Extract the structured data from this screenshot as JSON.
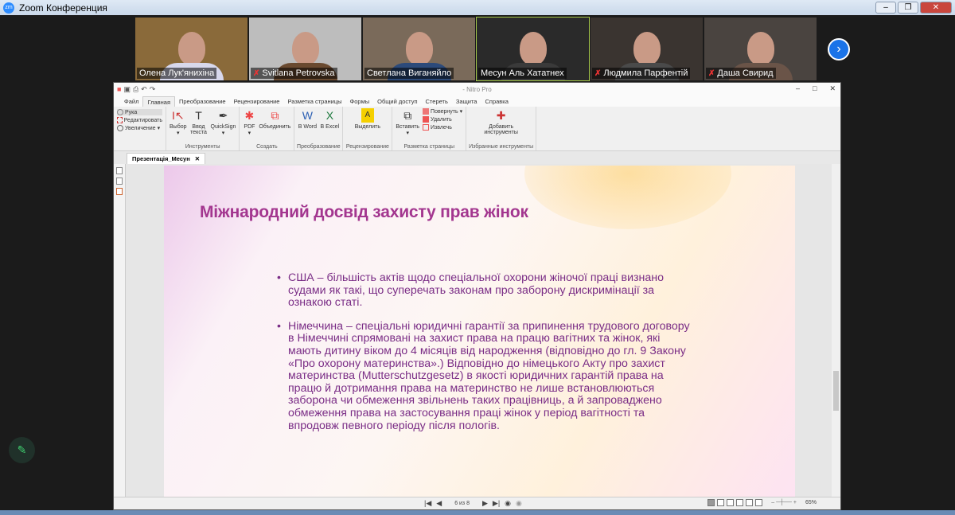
{
  "window": {
    "title": "Zoom Конференция",
    "logo": "zm"
  },
  "participants": [
    {
      "name": "Олена Лук'янихіна",
      "muted": false,
      "active": false
    },
    {
      "name": "Svitlana Petrovska",
      "muted": true,
      "active": false
    },
    {
      "name": "Светлана Виганяйло",
      "muted": false,
      "active": false
    },
    {
      "name": "Месун Аль Хататнех",
      "muted": false,
      "active": true
    },
    {
      "name": "Людмила Парфентій",
      "muted": true,
      "active": false
    },
    {
      "name": "Даша Свирид",
      "muted": true,
      "active": false
    }
  ],
  "nitro": {
    "title": "- Nitro Pro",
    "menu": [
      "Файл",
      "Главная",
      "Преобразование",
      "Рецензирование",
      "Разметка страницы",
      "Формы",
      "Общий доступ",
      "Стереть",
      "Защита",
      "Справка"
    ],
    "ribbon": {
      "nav": [
        "Рука",
        "Редактировать",
        "Увеличение"
      ],
      "tools": {
        "items": [
          "Выбор",
          "Ввод текста",
          "QuickSign"
        ],
        "label": "Инструменты"
      },
      "create": {
        "items": [
          "PDF",
          "Объединить"
        ],
        "label": "Создать"
      },
      "convert": {
        "items": [
          "В Word",
          "В Excel"
        ],
        "label": "Преобразование"
      },
      "review": {
        "items": [
          "Выделить"
        ],
        "label": "Рецензирование"
      },
      "page": {
        "insert": "Вставить",
        "items": [
          "Повернуть",
          "Удалить",
          "Извлечь"
        ],
        "label": "Разметка страницы"
      },
      "fav": {
        "items": [
          "Добавить инструменты"
        ],
        "label": "Избранные инструменты"
      }
    },
    "doc_tab": "Презентація_Месун",
    "slide": {
      "title": "Міжнародний досвід захисту прав жінок",
      "bullets": [
        "США  – більшість актів щодо спеціальної охорони жіночої праці визнано судами як такі, що суперечать законам про заборону дискримінації за ознакою статі.",
        "Німеччина – спеціальні юридичні гарантії за припинення трудового договору в Німеччині спрямовані на захист права на працю вагітних та жінок, які мають дитину віком до 4 місяців від народження (відповідно до гл. 9 Закону «Про охорону материнства».) Відповідно до німецького Акту про захист материнства (Mutterschutzgesetz) в якості юридичних гарантій права на працю й дотримання права на материнство не лише встановлюються заборона чи обмеження звільнень таких працівниць, а й запроваджено обмеження права на застосування праці жінок у період вагітності та впродовж певного періоду після пологів."
      ]
    },
    "status": {
      "page": "6 из 8",
      "zoom": "65%"
    }
  }
}
